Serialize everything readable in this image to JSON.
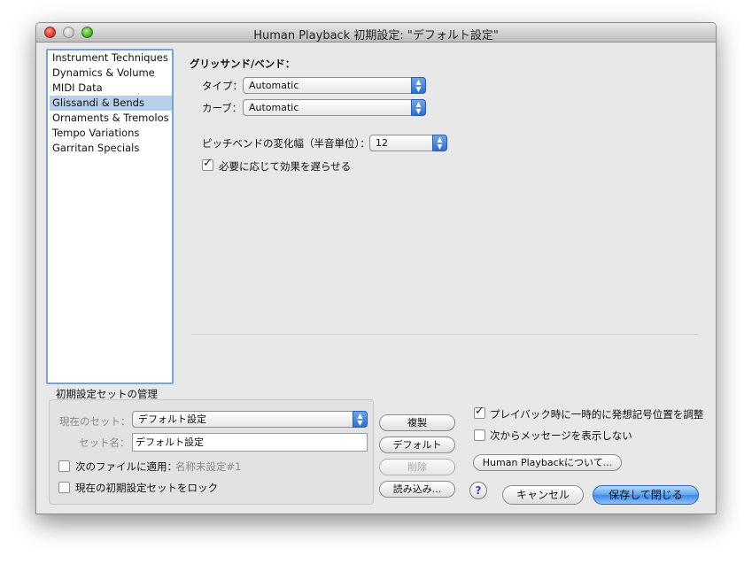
{
  "window": {
    "title": "Human Playback 初期設定: \"デフォルト設定\""
  },
  "sidebar": {
    "items": [
      {
        "label": "Instrument Techniques"
      },
      {
        "label": "Dynamics & Volume"
      },
      {
        "label": "MIDI Data"
      },
      {
        "label": "Glissandi & Bends"
      },
      {
        "label": "Ornaments & Tremolos"
      },
      {
        "label": "Tempo Variations"
      },
      {
        "label": "Garritan Specials"
      }
    ],
    "selected_index": 3
  },
  "panel": {
    "heading": "グリッサンド/ベンド：",
    "type_label": "タイプ：",
    "type_value": "Automatic",
    "curve_label": "カーブ：",
    "curve_value": "Automatic",
    "pitchbend_label": "ピッチベンドの変化幅（半音単位）：",
    "pitchbend_value": "12",
    "delay_label": "必要に応じて効果を遅らせる",
    "delay_checked": true
  },
  "preset": {
    "group_title": "初期設定セットの管理",
    "current_set_label": "現在のセット：",
    "current_set_value": "デフォルト設定",
    "set_name_label": "セット名：",
    "set_name_value": "デフォルト設定",
    "apply_label": "次のファイルに適用：",
    "apply_file": "名称未設定#1",
    "lock_label": "現在の初期設定セットをロック",
    "duplicate_button": "複製",
    "default_button": "デフォルト",
    "delete_button": "削除",
    "load_button": "読み込み..."
  },
  "options": {
    "adjust_label": "プレイバック時に一時的に発想記号位置を調整",
    "adjust_checked": true,
    "no_message_label": "次からメッセージを表示しない",
    "about_button": "Human Playbackについて...",
    "help_symbol": "?",
    "cancel_button": "キャンセル",
    "save_close_button": "保存して閉じる"
  }
}
